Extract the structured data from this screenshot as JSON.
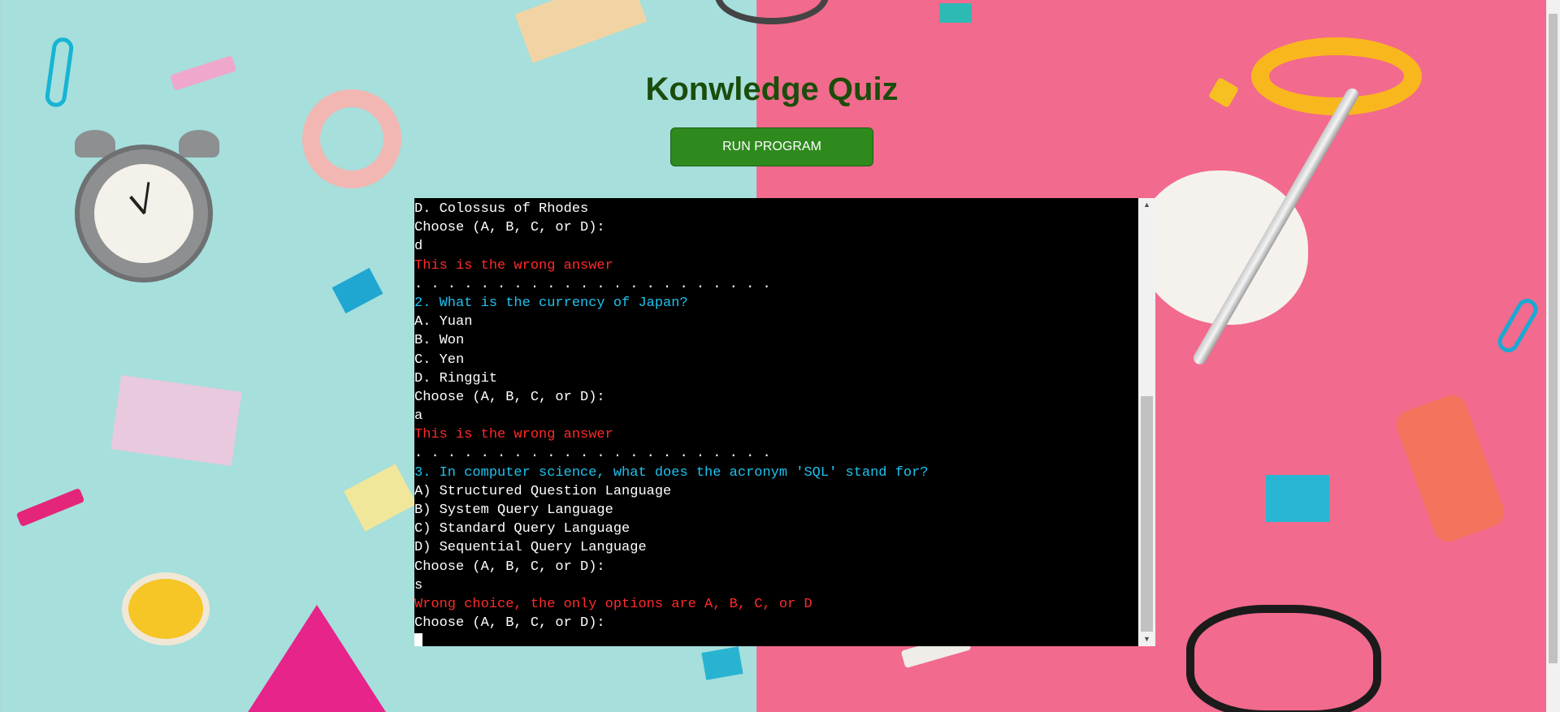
{
  "page": {
    "title": "Konwledge Quiz",
    "run_button": "RUN PROGRAM"
  },
  "terminal": {
    "lines": [
      {
        "text": "D. Colossus of Rhodes",
        "kind": "normal"
      },
      {
        "text": "Choose (A, B, C, or D):",
        "kind": "normal"
      },
      {
        "text": "d",
        "kind": "normal"
      },
      {
        "text": "This is the wrong answer",
        "kind": "wrong"
      },
      {
        "text": ". . . . . . . . . . . . . . . . . . . . . .",
        "kind": "normal"
      },
      {
        "text": "2. What is the currency of Japan?",
        "kind": "question"
      },
      {
        "text": "A. Yuan",
        "kind": "normal"
      },
      {
        "text": "B. Won",
        "kind": "normal"
      },
      {
        "text": "C. Yen",
        "kind": "normal"
      },
      {
        "text": "D. Ringgit",
        "kind": "normal"
      },
      {
        "text": "Choose (A, B, C, or D):",
        "kind": "normal"
      },
      {
        "text": "a",
        "kind": "normal"
      },
      {
        "text": "This is the wrong answer",
        "kind": "wrong"
      },
      {
        "text": ". . . . . . . . . . . . . . . . . . . . . .",
        "kind": "normal"
      },
      {
        "text": "3. In computer science, what does the acronym 'SQL' stand for?",
        "kind": "question"
      },
      {
        "text": "A) Structured Question Language",
        "kind": "normal"
      },
      {
        "text": "B) System Query Language",
        "kind": "normal"
      },
      {
        "text": "C) Standard Query Language",
        "kind": "normal"
      },
      {
        "text": "D) Sequential Query Language",
        "kind": "normal"
      },
      {
        "text": "Choose (A, B, C, or D):",
        "kind": "normal"
      },
      {
        "text": "s",
        "kind": "normal"
      },
      {
        "text": "Wrong choice, the only options are A, B, C, or D",
        "kind": "wrong"
      },
      {
        "text": "Choose (A, B, C, or D):",
        "kind": "normal"
      }
    ],
    "colors": {
      "background": "#000000",
      "text": "#ffffff",
      "wrong": "#ff2a2a",
      "question": "#1ec2ef"
    },
    "scroll_arrows": {
      "up": "▲",
      "down": "▼"
    }
  },
  "colors": {
    "title": "#1a4d0b",
    "button": "#2f8a1e",
    "background_left": "#a6dfdc",
    "background_right": "#f26a8d"
  },
  "icons": [
    "scroll-up-arrow-icon",
    "scroll-down-arrow-icon"
  ]
}
